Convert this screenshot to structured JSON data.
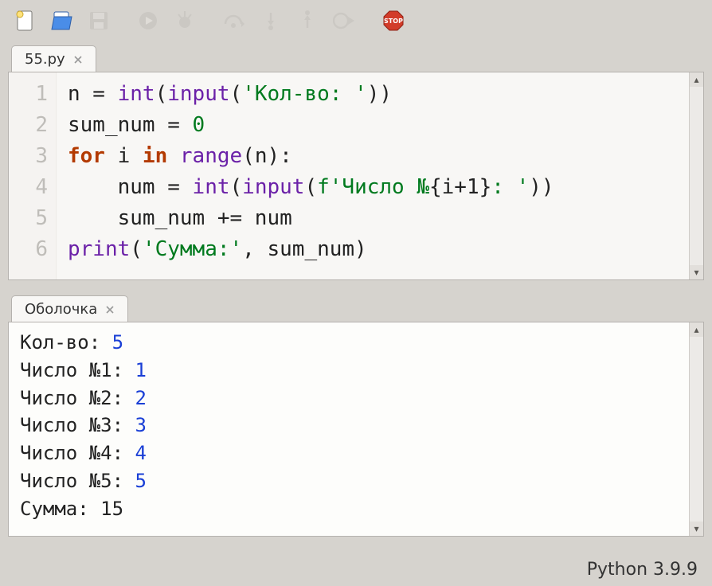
{
  "tabs": {
    "editor": "55.py",
    "shell": "Оболочка"
  },
  "toolbar_icons": [
    "new-file",
    "open-file",
    "save",
    "run",
    "debug",
    "step-over",
    "step-in",
    "step-out",
    "resume",
    "stop"
  ],
  "code_lines": [
    {
      "n": 1,
      "tokens": [
        [
          "plain",
          "n = "
        ],
        [
          "builtin",
          "int"
        ],
        [
          "plain",
          "("
        ],
        [
          "builtin",
          "input"
        ],
        [
          "plain",
          "("
        ],
        [
          "str",
          "'Кол-во: '"
        ],
        [
          "plain",
          "))"
        ]
      ]
    },
    {
      "n": 2,
      "tokens": [
        [
          "plain",
          "sum_num = "
        ],
        [
          "num",
          "0"
        ]
      ]
    },
    {
      "n": 3,
      "tokens": [
        [
          "kw",
          "for"
        ],
        [
          "plain",
          " i "
        ],
        [
          "kw",
          "in"
        ],
        [
          "plain",
          " "
        ],
        [
          "builtin",
          "range"
        ],
        [
          "plain",
          "(n):"
        ]
      ]
    },
    {
      "n": 4,
      "tokens": [
        [
          "plain",
          "    num = "
        ],
        [
          "builtin",
          "int"
        ],
        [
          "plain",
          "("
        ],
        [
          "builtin",
          "input"
        ],
        [
          "plain",
          "("
        ],
        [
          "fstr",
          "f'Число №"
        ],
        [
          "fexpr",
          "{i+1}"
        ],
        [
          "fstr",
          ": '"
        ],
        [
          "plain",
          "))"
        ]
      ]
    },
    {
      "n": 5,
      "tokens": [
        [
          "plain",
          "    sum_num += num"
        ]
      ]
    },
    {
      "n": 6,
      "tokens": [
        [
          "builtin",
          "print"
        ],
        [
          "plain",
          "("
        ],
        [
          "str",
          "'Сумма:'"
        ],
        [
          "plain",
          ", sum_num)"
        ]
      ]
    }
  ],
  "shell_lines": [
    {
      "parts": [
        [
          "plain",
          "Кол-во: "
        ],
        [
          "user",
          "5"
        ]
      ]
    },
    {
      "parts": [
        [
          "plain",
          "Число №1: "
        ],
        [
          "user",
          "1"
        ]
      ]
    },
    {
      "parts": [
        [
          "plain",
          "Число №2: "
        ],
        [
          "user",
          "2"
        ]
      ]
    },
    {
      "parts": [
        [
          "plain",
          "Число №3: "
        ],
        [
          "user",
          "3"
        ]
      ]
    },
    {
      "parts": [
        [
          "plain",
          "Число №4: "
        ],
        [
          "user",
          "4"
        ]
      ]
    },
    {
      "parts": [
        [
          "plain",
          "Число №5: "
        ],
        [
          "user",
          "5"
        ]
      ]
    },
    {
      "parts": [
        [
          "plain",
          "Сумма: 15"
        ]
      ]
    }
  ],
  "status": "Python 3.9.9"
}
